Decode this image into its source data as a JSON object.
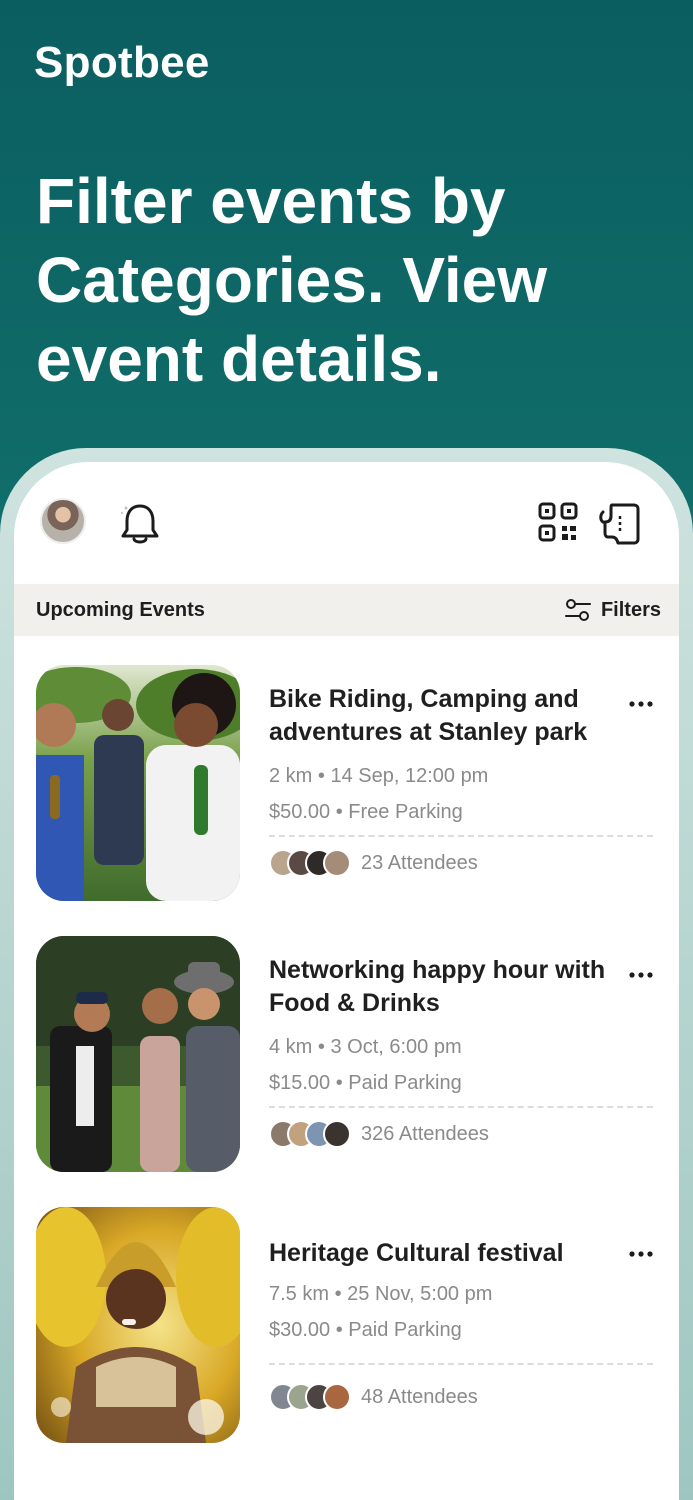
{
  "brand": "Spotbee",
  "headline": "Filter events by Categories. View event details.",
  "app": {
    "section_title": "Upcoming Events",
    "filters_label": "Filters",
    "icons": [
      "bell-icon",
      "qr-code-icon",
      "ticket-icon",
      "filters-icon",
      "more-icon"
    ]
  },
  "events": [
    {
      "title": "Bike Riding, Camping and adventures at Stanley park",
      "distance_date": "2 km • 14 Sep, 12:00 pm",
      "price_parking": "$50.00  •  Free Parking",
      "attendees": "23 Attendees"
    },
    {
      "title": "Networking happy hour with Food & Drinks",
      "distance_date": "4 km • 3 Oct, 6:00 pm",
      "price_parking": "$15.00  •  Paid Parking",
      "attendees": "326 Attendees"
    },
    {
      "title": "Heritage Cultural festival",
      "distance_date": "7.5 km  • 25 Nov, 5:00 pm",
      "price_parking": "$30.00  •  Paid Parking",
      "attendees": "48 Attendees"
    }
  ]
}
